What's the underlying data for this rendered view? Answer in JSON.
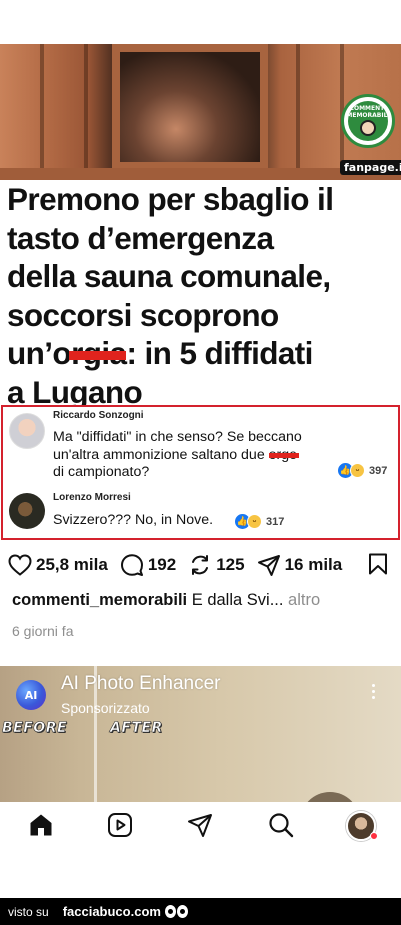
{
  "post_image": {
    "badge_text": "COMMENTI MEMORABILI",
    "source_label": "fanpage.it"
  },
  "headline": {
    "line1": "Premono per sbaglio il",
    "line2": "tasto d’emergenza",
    "line3": "della sauna comunale,",
    "line4": "soccorsi scoprono",
    "line5_prefix": "un’o",
    "line5_redacted": "rgia",
    "line5_suffix": ": in 5 diffidati",
    "line6": "a Lugano"
  },
  "comments": [
    {
      "author": "Riccardo Sonzogni",
      "text_line1": "Ma \"diffidati\" in che senso? Se beccano",
      "text_line2_prefix": "un'altra ammonizione saltano due ",
      "text_line2_redacted": "orge",
      "text_line3": "di campionato?",
      "reactions": "397"
    },
    {
      "author": "Lorenzo Morresi",
      "text": "Svizzero??? No, in Nove.",
      "reactions": "317"
    }
  ],
  "actions": {
    "likes": "25,8 mila",
    "comments": "192",
    "reposts": "125",
    "shares": "16 mila"
  },
  "caption": {
    "username": "commenti_memorabili",
    "text": " E dalla Svi",
    "ellipsis": "...",
    "more": " altro"
  },
  "time_ago": "6 giorni fa",
  "ad": {
    "logo_text": "AI",
    "title": "AI Photo Enhancer",
    "sponsored": "Sponsorizzato",
    "before": "BEFORE",
    "after": "AFTER"
  },
  "nav": {
    "items": [
      "home-icon",
      "reels-icon",
      "direct-icon",
      "search-icon",
      "profile-avatar"
    ]
  },
  "footer": {
    "visto": "visto su",
    "brand": "facciabuco.com"
  },
  "colors": {
    "red_frame": "#d4212d",
    "like_blue": "#1877f2",
    "badge_green": "#2e8b3e"
  }
}
